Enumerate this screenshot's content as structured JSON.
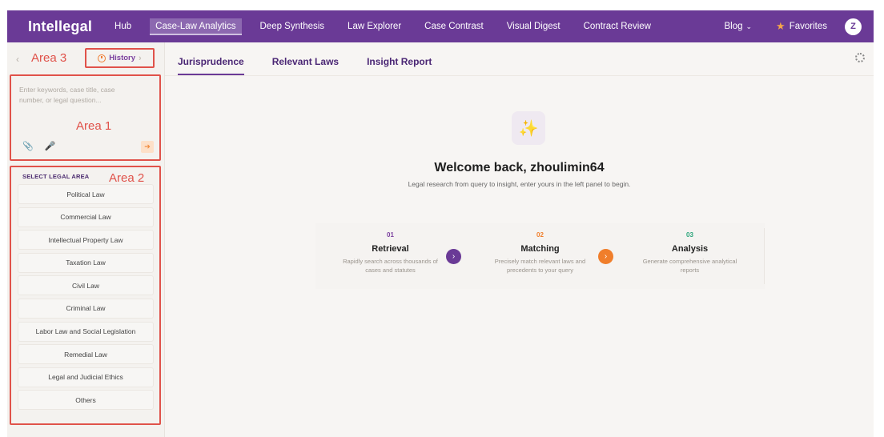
{
  "brand": "Intellegal",
  "nav": {
    "items": [
      {
        "label": "Hub",
        "active": false
      },
      {
        "label": "Case-Law Analytics",
        "active": true
      },
      {
        "label": "Deep Synthesis",
        "active": false
      },
      {
        "label": "Law Explorer",
        "active": false
      },
      {
        "label": "Case Contrast",
        "active": false
      },
      {
        "label": "Visual Digest",
        "active": false
      },
      {
        "label": "Contract Review",
        "active": false
      }
    ],
    "blog": "Blog",
    "favorites": "Favorites",
    "avatar_initial": "Z"
  },
  "annotations": {
    "area1": "Area 1",
    "area2": "Area 2",
    "area3": "Area 3",
    "color": "#e0524a"
  },
  "left": {
    "history_label": "History",
    "search_placeholder": "Enter keywords, case title, case number, or legal question...",
    "legal_area_title": "SELECT LEGAL AREA",
    "legal_areas": [
      "Political Law",
      "Commercial Law",
      "Intellectual Property Law",
      "Taxation Law",
      "Civil Law",
      "Criminal Law",
      "Labor Law and Social Legislation",
      "Remedial Law",
      "Legal and Judicial Ethics",
      "Others"
    ]
  },
  "main": {
    "tabs": [
      {
        "label": "Jurisprudence",
        "active": true
      },
      {
        "label": "Relevant Laws",
        "active": false
      },
      {
        "label": "Insight Report",
        "active": false
      }
    ],
    "welcome": "Welcome back, zhoulimin64",
    "subtitle": "Legal research from query to insight, enter yours in the left panel to begin.",
    "steps": [
      {
        "num": "01",
        "title": "Retrieval",
        "desc": "Rapidly search across thousands of cases and statutes",
        "color": "#7a3f9e"
      },
      {
        "num": "02",
        "title": "Matching",
        "desc": "Precisely match relevant laws and precedents to your query",
        "color": "#f07e2b"
      },
      {
        "num": "03",
        "title": "Analysis",
        "desc": "Generate comprehensive analytical reports",
        "color": "#2aa47a"
      }
    ]
  },
  "colors": {
    "brand_purple": "#6a3a96",
    "accent_orange": "#f07e2b"
  }
}
